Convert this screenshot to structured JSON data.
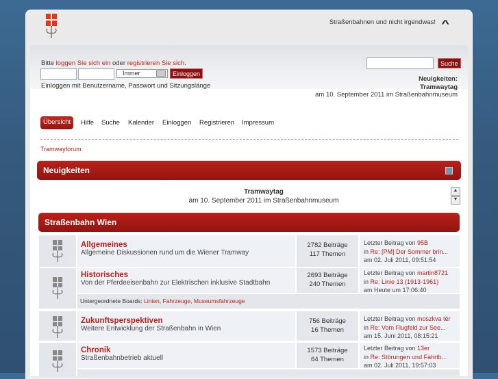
{
  "header": {
    "slogan": "Straßenbahnen und nicht irgendwas!"
  },
  "login": {
    "prefix": "Bitte ",
    "login_link": "loggen Sie sich ein",
    "middle": " oder ",
    "register_link": "registrieren Sie sich",
    "suffix": ".",
    "duration": "Immer",
    "submit": "Einloggen",
    "hint": "Einloggen mit Benutzername, Passwort und Sitzungslänge"
  },
  "search": {
    "button": "Suche"
  },
  "news_top": {
    "label": "Neuigkeiten:",
    "title": "Tramwaytag",
    "text": "am 10. September 2011 im Straßenbahnmuseum"
  },
  "nav": [
    "Übersicht",
    "Hilfe",
    "Suche",
    "Kalender",
    "Einloggen",
    "Registrieren",
    "Impressum"
  ],
  "breadcrumb": "Tramwayforum",
  "news": {
    "header": "Neuigkeiten",
    "title": "Tramwaytag",
    "text": "am 10. September 2011 im Straßenbahnmuseum"
  },
  "category": "Straßenbahn Wien",
  "boards": [
    {
      "name": "Allgemeines",
      "desc": "Allgemeine Diskussionen rund um die Wiener Tramway",
      "posts": "2782 Beiträge",
      "topics": "117 Themen",
      "lp_by": "95B",
      "lp_in": "Re: [PM] Der Sommer brin...",
      "lp_at": "am 02. Juli 2011, 09:51:54"
    },
    {
      "name": "Historisches",
      "desc": "Von der Pferdeeisenbahn zur Elektrischen inklusive Stadtbahn",
      "posts": "2693 Beiträge",
      "topics": "240 Themen",
      "lp_by": "martin8721",
      "lp_in": "Re: Linie 13 (1913-1961)",
      "lp_at": "am Heute um 17:06:40"
    },
    {
      "name": "Zukunftsperspektiven",
      "desc": "Weitere Entwicklung der Straßenbahn in Wien",
      "posts": "756 Beiträge",
      "topics": "16 Themen",
      "lp_by": "moszkva tér",
      "lp_in": "Re: Vom Flugfeld zur See...",
      "lp_at": "am 15. Juni 2011, 08:15:21"
    },
    {
      "name": "Chronik",
      "desc": "Straßenbahnbetrieb aktuell",
      "posts": "1573 Beiträge",
      "topics": "64 Themen",
      "lp_by": "13er",
      "lp_in": "Re: Störungen und Fahrtb...",
      "lp_at": "am 02. Juli 2011, 19:57:03"
    }
  ],
  "child_boards": {
    "label": "Untergeordnete Boards: ",
    "items": [
      "Linien",
      "Fahrzeuge",
      "Museumsfahrzeuge"
    ]
  },
  "lp_labels": {
    "last": "Letzter Beitrag",
    "by": " von ",
    "in": "in "
  }
}
